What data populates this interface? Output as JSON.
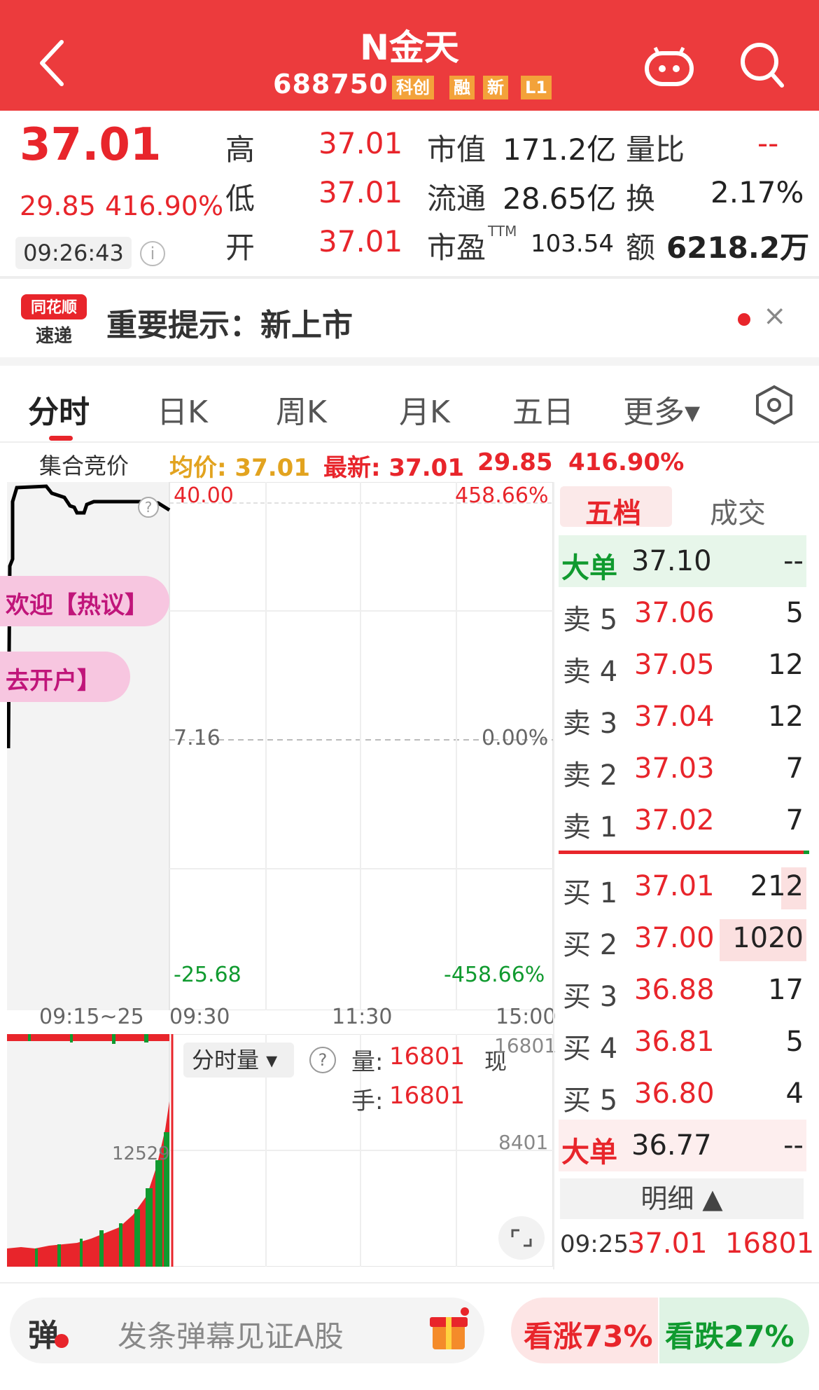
{
  "header": {
    "stock_name": "N金天",
    "stock_code": "688750",
    "tags": [
      "科创",
      "融",
      "新",
      "L1"
    ]
  },
  "quote": {
    "last_price": "37.01",
    "change": "29.85",
    "change_pct": "416.90%",
    "time": "09:26:43",
    "fields": [
      {
        "label": "高",
        "value": "37.01"
      },
      {
        "label": "低",
        "value": "37.01"
      },
      {
        "label": "开",
        "value": "37.01"
      }
    ],
    "mid": [
      {
        "label": "市值",
        "value": "171.2亿"
      },
      {
        "label": "流通",
        "value": "28.65亿"
      },
      {
        "label": "市盈",
        "sup": "TTM",
        "value": "103.54"
      }
    ],
    "right": [
      {
        "label": "量比",
        "value": "--"
      },
      {
        "label": "换",
        "value": "2.17%"
      },
      {
        "label": "额",
        "value": "6218.2万"
      }
    ]
  },
  "notice": {
    "logo_line1": "同花顺",
    "logo_line2": "速递",
    "text": "重要提示：新上市",
    "close": "×"
  },
  "tabs": [
    "分时",
    "日K",
    "周K",
    "月K",
    "五日",
    "更多▾"
  ],
  "chart": {
    "auction_label": "集合竞价",
    "avg_label": "均价: 37.01",
    "latest_label": "最新: 37.01",
    "change": "29.85",
    "change_pct": "416.90%",
    "y_top": "40.00",
    "y_top_pct": "458.66%",
    "y_mid": "7.16",
    "y_mid_pct": "0.00%",
    "y_bottom": "-25.68",
    "y_bottom_pct": "-458.66%",
    "x_labels": [
      "09:15~25",
      "09:30",
      "11:30",
      "15:00"
    ],
    "bubble1": "欢迎【热议】",
    "bubble2": "去开户】",
    "volume_selector": "分时量 ▾",
    "vol_label": "量:",
    "vol_value": "16801",
    "hand_label": "手:",
    "hand_value": "16801",
    "now_label": "现",
    "vol_axis_top": "16801",
    "vol_axis_mid": "8401",
    "auction_vol_label": "12529"
  },
  "orderbook": {
    "tab_active": "五档",
    "tab_other": "成交",
    "big_sell": {
      "label": "大单",
      "price": "37.10",
      "vol": "--"
    },
    "asks": [
      {
        "label": "卖 5",
        "price": "37.06",
        "vol": "5"
      },
      {
        "label": "卖 4",
        "price": "37.05",
        "vol": "12"
      },
      {
        "label": "卖 3",
        "price": "37.04",
        "vol": "12"
      },
      {
        "label": "卖 2",
        "price": "37.03",
        "vol": "7"
      },
      {
        "label": "卖 1",
        "price": "37.02",
        "vol": "7"
      }
    ],
    "bids": [
      {
        "label": "买 1",
        "price": "37.01",
        "vol": "212"
      },
      {
        "label": "买 2",
        "price": "37.00",
        "vol": "1020"
      },
      {
        "label": "买 3",
        "price": "36.88",
        "vol": "17"
      },
      {
        "label": "买 4",
        "price": "36.81",
        "vol": "5"
      },
      {
        "label": "买 5",
        "price": "36.80",
        "vol": "4"
      }
    ],
    "big_buy": {
      "label": "大单",
      "price": "36.77",
      "vol": "--"
    },
    "detail_label": "明细 ▲",
    "trade": {
      "time": "09:25",
      "price": "37.01",
      "vol": "16801"
    }
  },
  "bottom": {
    "danmu_icon": "弹",
    "danmu_placeholder": "发条弹幕见证A股",
    "up_label": "看涨73%",
    "down_label": "看跌27%"
  },
  "colors": {
    "header": "#ec3b3d",
    "up": "#e8252b",
    "down": "#109a2f",
    "accent_gold": "#e2a31f"
  }
}
